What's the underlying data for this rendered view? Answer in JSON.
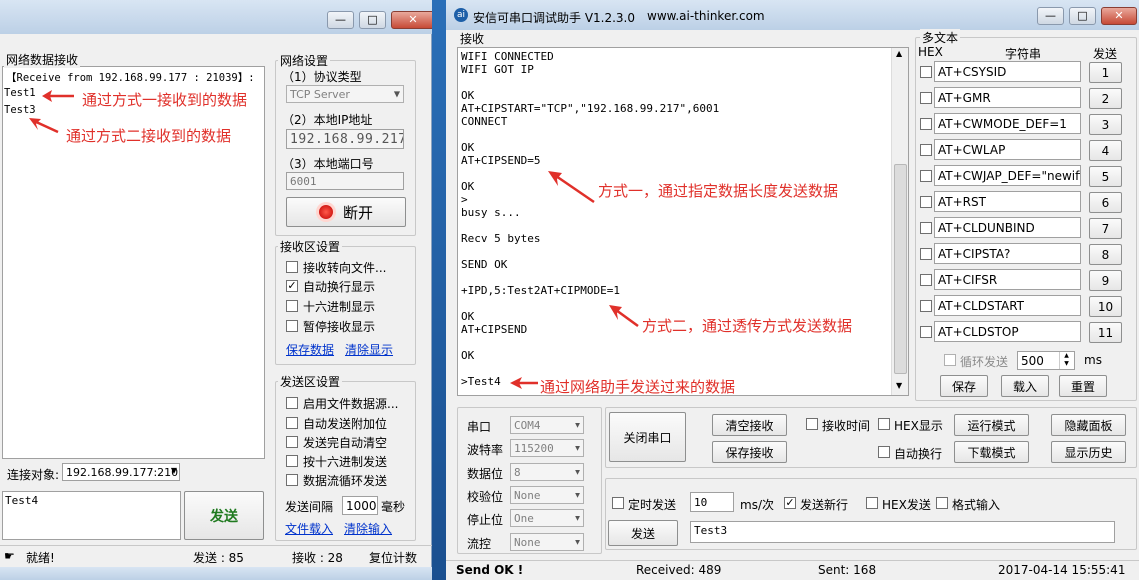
{
  "left": {
    "window_buttons": {
      "min": "—",
      "max": "□",
      "close": "✕"
    },
    "recv_title": "网络数据接收",
    "recv_lines": [
      "【Receive from 192.168.99.177 : 21039】:",
      "Test1",
      "Test3"
    ],
    "net_title": "网络设置",
    "protocol_label": "（1）协议类型",
    "protocol_value": "TCP Server",
    "ip_label": "（2）本地IP地址",
    "ip_value": "192.168.99.217",
    "port_label": "（3）本地端口号",
    "port_value": "6001",
    "disconnect_label": "断开",
    "recv_settings_title": "接收区设置",
    "recv_options": [
      {
        "label": "接收转向文件...",
        "checked": false
      },
      {
        "label": "自动换行显示",
        "checked": true
      },
      {
        "label": "十六进制显示",
        "checked": false
      },
      {
        "label": "暂停接收显示",
        "checked": false
      }
    ],
    "save_data_link": "保存数据",
    "clear_display_link": "清除显示",
    "send_settings_title": "发送区设置",
    "send_options": [
      {
        "label": "启用文件数据源...",
        "checked": false
      },
      {
        "label": "自动发送附加位",
        "checked": false
      },
      {
        "label": "发送完自动清空",
        "checked": false
      },
      {
        "label": "按十六进制发送",
        "checked": false
      },
      {
        "label": "数据流循环发送",
        "checked": false
      }
    ],
    "interval_label": "发送间隔",
    "interval_value": "1000",
    "interval_unit": "毫秒",
    "file_load_link": "文件载入",
    "clear_input_link": "清除输入",
    "target_label": "连接对象:",
    "target_value": "192.168.99.177:210",
    "send_text": "Test4",
    "send_button": "发送",
    "status_ready": "就绪!",
    "status_sent": "发送 : 85",
    "status_recv": "接收 : 28",
    "status_reset": "复位计数",
    "annot1": "通过方式一接收到的数据",
    "annot2": "通过方式二接收到的数据"
  },
  "right": {
    "title": "安信可串口调试助手 V1.2.3.0",
    "website": "www.ai-thinker.com",
    "window_buttons": {
      "min": "—",
      "max": "□",
      "close": "✕"
    },
    "recv_title": "接收",
    "recv_lines": [
      "WIFI CONNECTED",
      "WIFI GOT IP",
      "",
      "OK",
      "AT+CIPSTART=\"TCP\",\"192.168.99.217\",6001",
      "CONNECT",
      "",
      "OK",
      "AT+CIPSEND=5",
      "",
      "OK",
      ">",
      "busy s...",
      "",
      "Recv 5 bytes",
      "",
      "SEND OK",
      "",
      "+IPD,5:Test2AT+CIPMODE=1",
      "",
      "OK",
      "AT+CIPSEND",
      "",
      "OK",
      "",
      ">Test4"
    ],
    "annot1": "方式一，通过指定数据长度发送数据",
    "annot2": "方式二，通过透传方式发送数据",
    "annot3": "通过网络助手发送过来的数据",
    "multi_title": "多文本",
    "multi_hex": "HEX",
    "multi_str": "字符串",
    "multi_send": "发送",
    "multi_rows": [
      {
        "text": "AT+CSYSID",
        "num": "1"
      },
      {
        "text": "AT+GMR",
        "num": "2"
      },
      {
        "text": "AT+CWMODE_DEF=1",
        "num": "3"
      },
      {
        "text": "AT+CWLAP",
        "num": "4"
      },
      {
        "text": "AT+CWJAP_DEF=\"newifi_",
        "num": "5"
      },
      {
        "text": "AT+RST",
        "num": "6"
      },
      {
        "text": "AT+CLDUNBIND",
        "num": "7"
      },
      {
        "text": "AT+CIPSTA?",
        "num": "8"
      },
      {
        "text": "AT+CIFSR",
        "num": "9"
      },
      {
        "text": "AT+CLDSTART",
        "num": "10"
      },
      {
        "text": "AT+CLDSTOP",
        "num": "11"
      }
    ],
    "loop_label": "循环发送",
    "loop_value": "500",
    "loop_unit": "ms",
    "save_btn": "保存",
    "load_btn": "载入",
    "reset_btn": "重置",
    "serial_labels": [
      "串口",
      "波特率",
      "数据位",
      "校验位",
      "停止位",
      "流控"
    ],
    "serial_values": [
      "COM4",
      "115200",
      "8",
      "None",
      "One",
      "None"
    ],
    "close_port_btn": "关闭串口",
    "clear_recv_btn": "清空接收",
    "save_recv_btn": "保存接收",
    "recv_time_label": "接收时间",
    "hex_display_label": "HEX显示",
    "run_mode_btn": "运行模式",
    "hide_panel_btn": "隐藏面板",
    "auto_wrap_label": "自动换行",
    "download_mode_btn": "下载模式",
    "show_history_btn": "显示历史",
    "timed_send_label": "定时发送",
    "timed_value": "10",
    "timed_unit": "ms/次",
    "send_newline_label": "发送新行",
    "hex_send_label": "HEX发送",
    "format_input_label": "格式输入",
    "send_btn": "发送",
    "send_text": "Test3",
    "status_ok": "Send OK !",
    "status_received": "Received: 489",
    "status_sent": "Sent: 168",
    "status_time": "2017-04-14 15:55:41"
  },
  "colors": {
    "annotation": "#e0302a",
    "link": "#0033cc",
    "send_green": "#1f7a1f",
    "title_bg": "#c5d6ea"
  }
}
